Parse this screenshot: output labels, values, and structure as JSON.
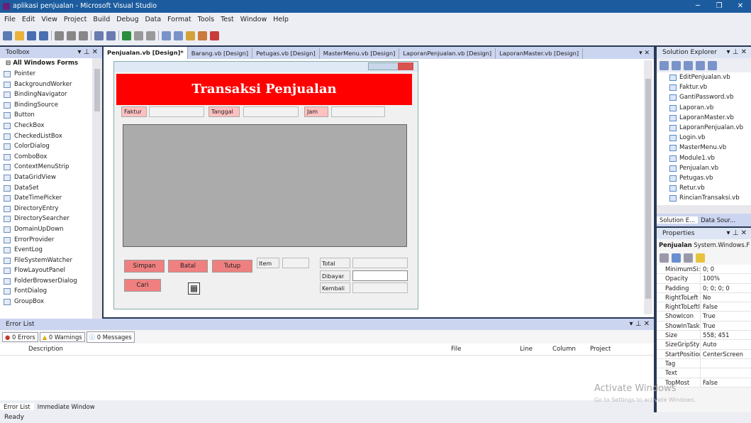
{
  "window": {
    "title": "aplikasi penjualan - Microsoft Visual Studio"
  },
  "menu": [
    "File",
    "Edit",
    "View",
    "Project",
    "Build",
    "Debug",
    "Data",
    "Format",
    "Tools",
    "Test",
    "Window",
    "Help"
  ],
  "toolbox": {
    "title": "Toolbox",
    "group": "All Windows Forms",
    "items": [
      "Pointer",
      "BackgroundWorker",
      "BindingNavigator",
      "BindingSource",
      "Button",
      "CheckBox",
      "CheckedListBox",
      "ColorDialog",
      "ComboBox",
      "ContextMenuStrip",
      "DataGridView",
      "DataSet",
      "DateTimePicker",
      "DirectoryEntry",
      "DirectorySearcher",
      "DomainUpDown",
      "ErrorProvider",
      "EventLog",
      "FileSystemWatcher",
      "FlowLayoutPanel",
      "FolderBrowserDialog",
      "FontDialog",
      "GroupBox"
    ]
  },
  "tabs": [
    "Penjualan.vb [Design]*",
    "Barang.vb [Design]",
    "Petugas.vb [Design]",
    "MasterMenu.vb [Design]",
    "LaporanPenjualan.vb [Design]",
    "LaporanMaster.vb [Design]"
  ],
  "form": {
    "header": "Transaksi Penjualan",
    "faktur": "Faktur",
    "tanggal": "Tanggal",
    "jam": "Jam",
    "simpan": "Simpan",
    "batal": "Batal",
    "tutup": "Tutup",
    "cari": "Cari",
    "item": "Item",
    "total": "Total",
    "dibayar": "Dibayar",
    "kembali": "Kembali"
  },
  "errorlist": {
    "title": "Error List",
    "errors": "0 Errors",
    "warnings": "0 Warnings",
    "messages": "0 Messages",
    "cols": [
      "Description",
      "File",
      "Line",
      "Column",
      "Project"
    ],
    "bottom_tabs": [
      "Error List",
      "Immediate Window"
    ]
  },
  "solution": {
    "title": "Solution Explorer",
    "files": [
      "EditPenjualan.vb",
      "Faktur.vb",
      "GantiPassword.vb",
      "Laporan.vb",
      "LaporanMaster.vb",
      "LaporanPenjualan.vb",
      "Login.vb",
      "MasterMenu.vb",
      "Module1.vb",
      "Penjualan.vb",
      "Petugas.vb",
      "Retur.vb",
      "RincianTransaksi.vb"
    ],
    "tabs": [
      "Solution E...",
      "Data Sour..."
    ]
  },
  "properties": {
    "title": "Properties",
    "object": "Penjualan",
    "object_type": "System.Windows.F",
    "rows": [
      [
        "MinimumSi:",
        "0; 0"
      ],
      [
        "Opacity",
        "100%"
      ],
      [
        "Padding",
        "0; 0; 0; 0"
      ],
      [
        "RightToLeft",
        "No"
      ],
      [
        "RightToLeftl",
        "False"
      ],
      [
        "ShowIcon",
        "True"
      ],
      [
        "ShowInTaskl",
        "True"
      ],
      [
        "Size",
        "558; 451"
      ],
      [
        "SizeGripStyl",
        "Auto"
      ],
      [
        "StartPositior",
        "CenterScreen"
      ],
      [
        "Tag",
        ""
      ],
      [
        "Text",
        ""
      ],
      [
        "TopMost",
        "False"
      ]
    ]
  },
  "watermark": {
    "line1": "Activate Windows",
    "line2": "Go to Settings to activate Windows."
  },
  "status": "Ready"
}
